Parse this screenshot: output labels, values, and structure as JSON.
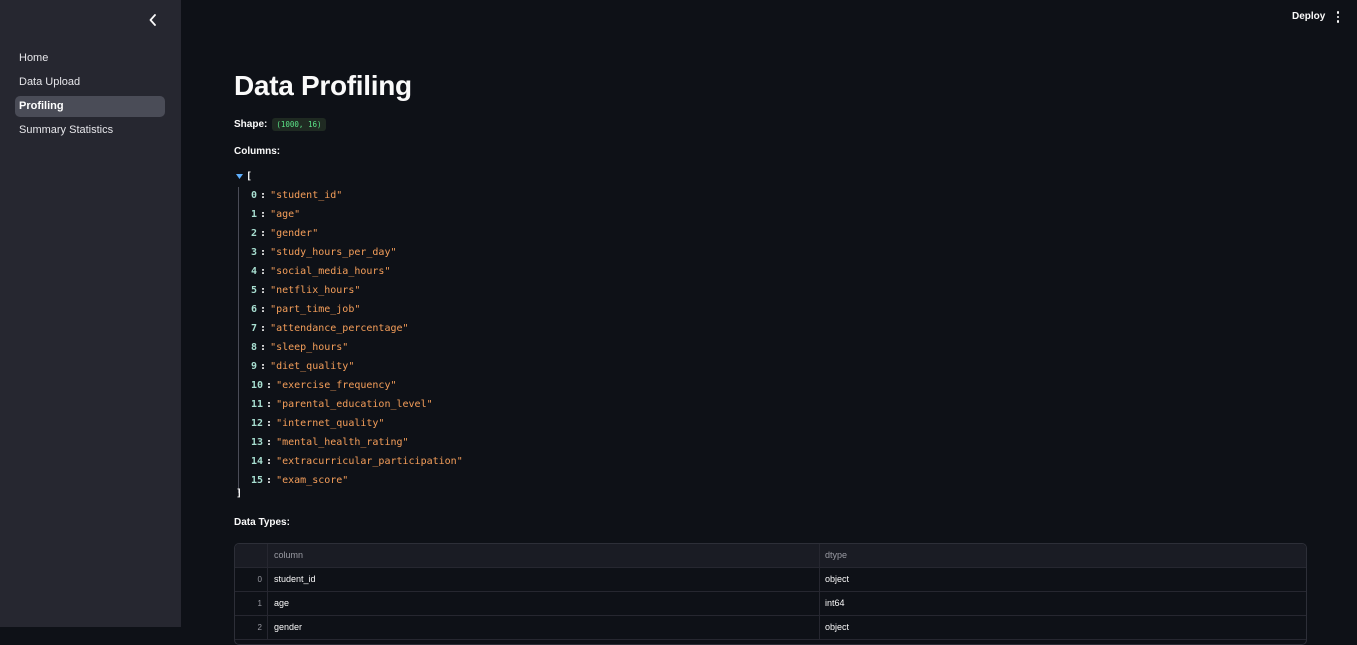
{
  "sidebar": {
    "collapse_icon": "chevron-left-icon",
    "items": [
      {
        "label": "Home",
        "active": false
      },
      {
        "label": "Data Upload",
        "active": false
      },
      {
        "label": "Profiling",
        "active": true
      },
      {
        "label": "Summary Statistics",
        "active": false
      }
    ]
  },
  "toolbar": {
    "deploy_label": "Deploy",
    "menu_icon": "kebab-menu-icon"
  },
  "main": {
    "title": "Data Profiling",
    "shape_label": "Shape:",
    "shape_value": "(1000, 16)",
    "columns_label": "Columns:",
    "json": {
      "open_bracket": "[",
      "close_bracket": "]",
      "items": [
        {
          "index": "0",
          "value": "\"student_id\""
        },
        {
          "index": "1",
          "value": "\"age\""
        },
        {
          "index": "2",
          "value": "\"gender\""
        },
        {
          "index": "3",
          "value": "\"study_hours_per_day\""
        },
        {
          "index": "4",
          "value": "\"social_media_hours\""
        },
        {
          "index": "5",
          "value": "\"netflix_hours\""
        },
        {
          "index": "6",
          "value": "\"part_time_job\""
        },
        {
          "index": "7",
          "value": "\"attendance_percentage\""
        },
        {
          "index": "8",
          "value": "\"sleep_hours\""
        },
        {
          "index": "9",
          "value": "\"diet_quality\""
        },
        {
          "index": "10",
          "value": "\"exercise_frequency\""
        },
        {
          "index": "11",
          "value": "\"parental_education_level\""
        },
        {
          "index": "12",
          "value": "\"internet_quality\""
        },
        {
          "index": "13",
          "value": "\"mental_health_rating\""
        },
        {
          "index": "14",
          "value": "\"extracurricular_participation\""
        },
        {
          "index": "15",
          "value": "\"exam_score\""
        }
      ]
    },
    "dtypes_label": "Data Types:",
    "table": {
      "headers": {
        "column": "column",
        "dtype": "dtype"
      },
      "rows": [
        {
          "index": "0",
          "column": "student_id",
          "dtype": "object"
        },
        {
          "index": "1",
          "column": "age",
          "dtype": "int64"
        },
        {
          "index": "2",
          "column": "gender",
          "dtype": "object"
        }
      ]
    }
  },
  "colors": {
    "background": "#0e1117",
    "sidebar": "#262730",
    "active_nav": "#4a4c57",
    "json_index": "#a8dfd1",
    "json_string": "#f49e5a",
    "code_green": "#5ce488"
  }
}
